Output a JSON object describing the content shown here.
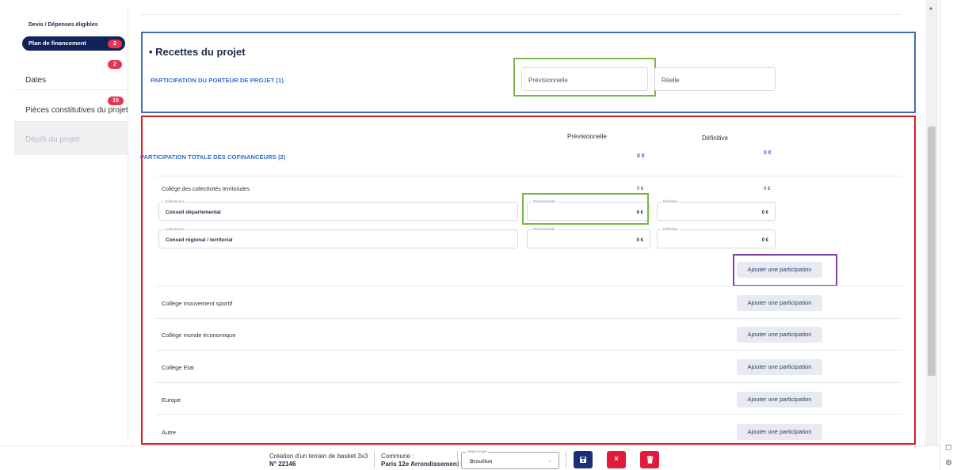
{
  "sidebar": {
    "top_label": "Devis / Dépenses éligibles",
    "active_item": {
      "label": "Plan de financement",
      "badge": "2"
    },
    "items": [
      {
        "label": "Dates",
        "badge": "2"
      },
      {
        "label": "Pièces constitutives du projet",
        "badge": "10"
      }
    ],
    "disabled_item": {
      "label": "Dépôt du projet"
    }
  },
  "recettes": {
    "title": "Recettes du projet",
    "porteur_label": "PARTICIPATION DU PORTEUR DE PROJET (1)",
    "previsionnelle_placeholder": "Prévisionnelle",
    "reelle_placeholder": "Réelle"
  },
  "cofinanceurs": {
    "col_previsionnelle": "Prévisionnelle",
    "col_definitive": "Définitive",
    "total_label": "PARTICIPATION TOTALE DES COFINANCEURS (2)",
    "total_previsionnelle": "0 €",
    "total_definitive": "0 €",
    "college_collectivites": {
      "label": "Collège des collectivités territoriales",
      "previsionnelle": "0 €",
      "definitive": "0 €",
      "rows": [
        {
          "cofinanceur_legend": "Cofinanceur",
          "cofinanceur": "Conseil départemental",
          "prev_legend": "Prévisionnelle",
          "prev": "0 €",
          "def_legend": "Définitive",
          "def": "0 €"
        },
        {
          "cofinanceur_legend": "Cofinanceur",
          "cofinanceur": "Conseil régional / territorial",
          "prev_legend": "Prévisionnelle",
          "prev": "0 €",
          "def_legend": "Définitive",
          "def": "0 €"
        }
      ]
    },
    "add_label": "Ajouter une participation",
    "colleges": [
      "Collège mouvement sportif",
      "Collège monde économique",
      "Collège Etat",
      "Europe",
      "Autre"
    ]
  },
  "bottom_bar": {
    "project_title": "Création d'un terrain de basket 3x3",
    "project_number": "N° 22146",
    "commune_label": "Commune :",
    "commune_value": "Paris 12e Arrondissement",
    "status_legend": "Statut projet",
    "status_value": "Brouillon",
    "save_icon": "save-icon",
    "cancel_icon": "close-icon",
    "delete_icon": "trash-icon"
  },
  "colors": {
    "primary": "#12235a",
    "accent_blue": "#2d6bd1",
    "badge_red": "#e8344e",
    "action_blue": "#1a2f78",
    "action_red": "#e01b3c"
  }
}
